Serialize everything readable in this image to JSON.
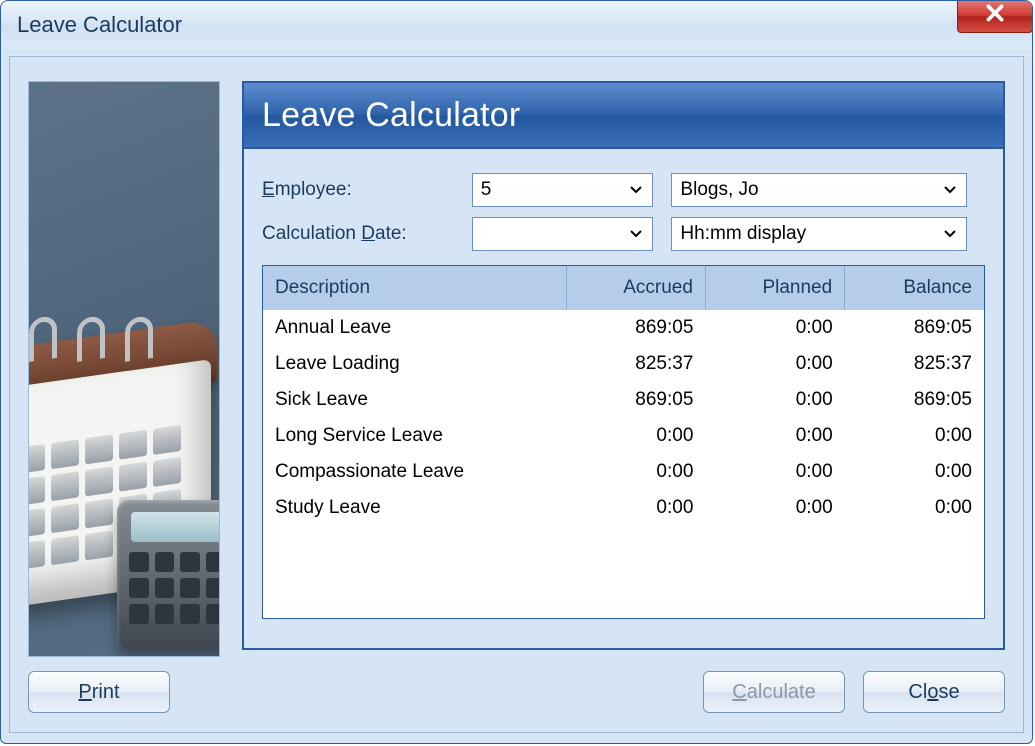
{
  "window": {
    "title": "Leave Calculator"
  },
  "panel": {
    "heading": "Leave Calculator"
  },
  "form": {
    "employee_label": "Employee:",
    "employee_id": "5",
    "employee_name": "Blogs, Jo",
    "calc_date_label": "Calculation Date:",
    "calc_date_value": "",
    "display_mode": "Hh:mm display"
  },
  "table": {
    "headers": {
      "description": "Description",
      "accrued": "Accrued",
      "planned": "Planned",
      "balance": "Balance"
    },
    "rows": [
      {
        "description": "Annual Leave",
        "accrued": "869:05",
        "planned": "0:00",
        "balance": "869:05"
      },
      {
        "description": "Leave Loading",
        "accrued": "825:37",
        "planned": "0:00",
        "balance": "825:37"
      },
      {
        "description": "Sick Leave",
        "accrued": "869:05",
        "planned": "0:00",
        "balance": "869:05"
      },
      {
        "description": "Long Service Leave",
        "accrued": "0:00",
        "planned": "0:00",
        "balance": "0:00"
      },
      {
        "description": "Compassionate Leave",
        "accrued": "0:00",
        "planned": "0:00",
        "balance": "0:00"
      },
      {
        "description": "Study Leave",
        "accrued": "0:00",
        "planned": "0:00",
        "balance": "0:00"
      }
    ]
  },
  "buttons": {
    "print": "Print",
    "calculate": "Calculate",
    "close": "Close"
  }
}
